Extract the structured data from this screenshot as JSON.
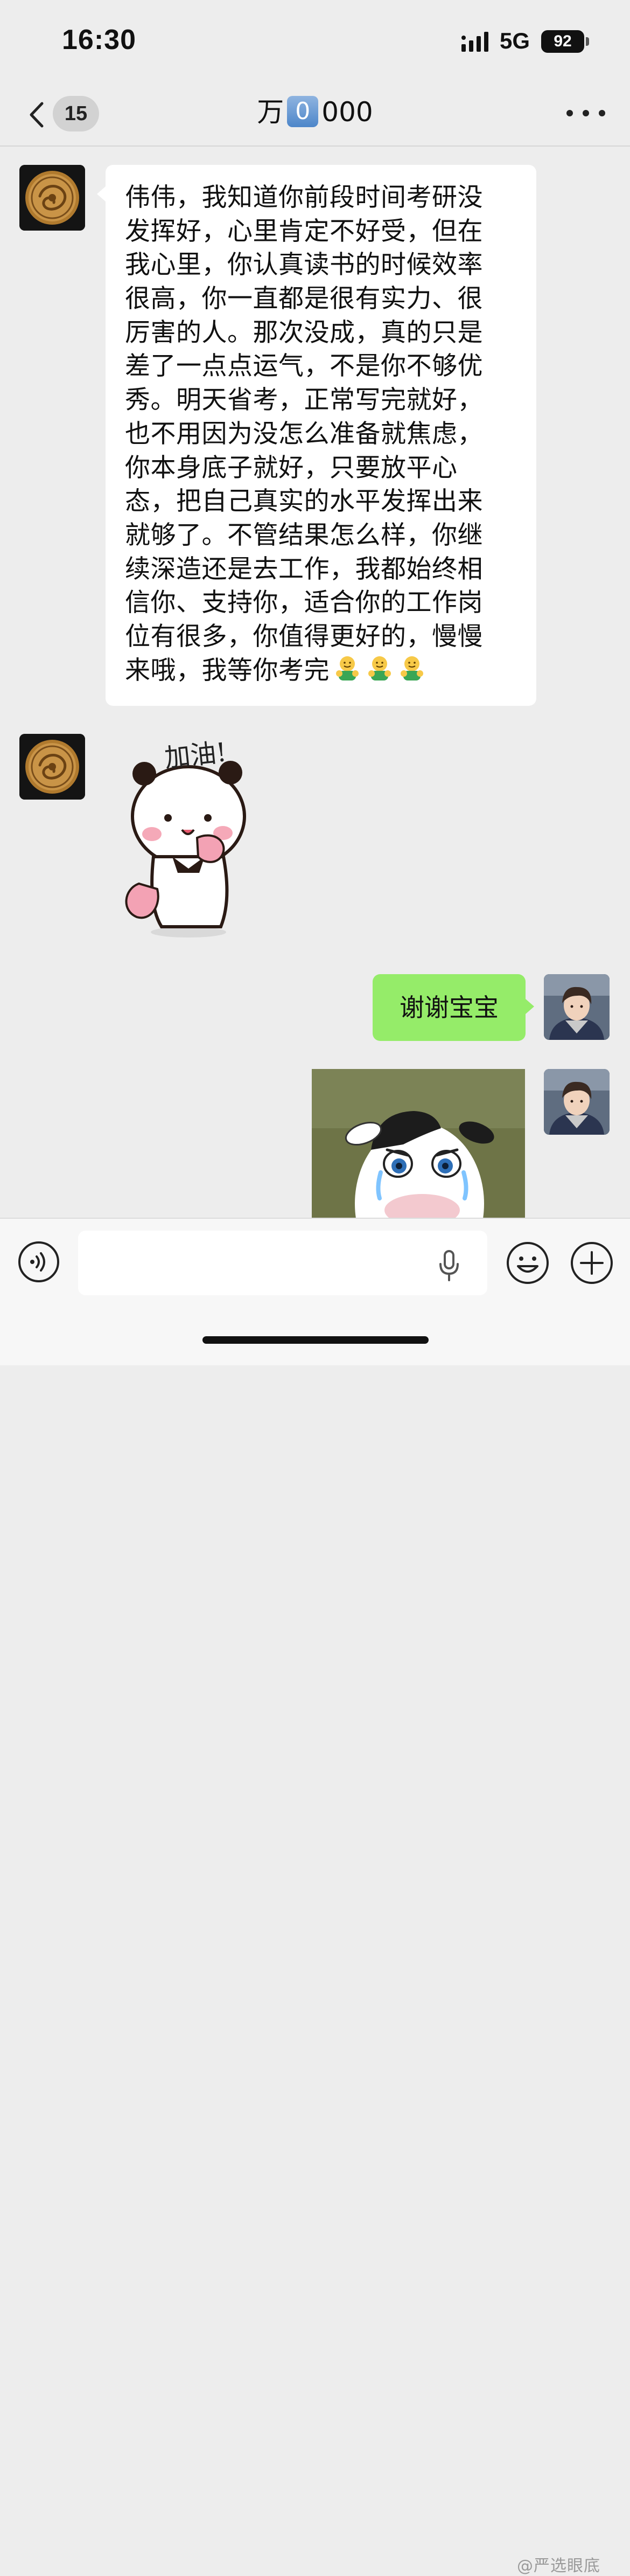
{
  "status_bar": {
    "time": "16:30",
    "network": "5G",
    "battery": "92",
    "signal_icon": "signal-bars-icon",
    "battery_icon": "battery-icon"
  },
  "nav": {
    "back_icon": "chevron-left-icon",
    "unread_count": "15",
    "title_prefix": "万",
    "title_boxed_digit": "0",
    "title_suffix": "000",
    "more_icon": "ellipsis-icon"
  },
  "messages": [
    {
      "sender": "contact",
      "type": "text",
      "lines": [
        "伟伟，我知道你前段时间考研没",
        "发挥好，心里肯定不好受，但在",
        "我心里，你认真读书的时候效率",
        "很高，你一直都是很有实力、很",
        "厉害的人。那次没成，真的只是",
        "差了一点点运气，不是你不够优",
        "秀。明天省考，正常写完就好，",
        "也不用因为没怎么准备就焦虑，",
        "你本身底子就好，只要放平心",
        "态，把自己真实的水平发挥出来",
        "就够了。不管结果怎么样，你继",
        "续深造还是去工作，我都始终相",
        "信你、支持你，适合你的工作岗",
        "位有很多，你值得更好的，慢慢",
        "来哦，我等你考完"
      ],
      "trailing_emoji": [
        "hug-emoji",
        "hug-emoji",
        "hug-emoji"
      ]
    },
    {
      "sender": "contact",
      "type": "sticker",
      "sticker": "panda-cheer-sticker",
      "caption": "加油!"
    },
    {
      "sender": "self",
      "type": "text",
      "text": "谢谢宝宝"
    },
    {
      "sender": "self",
      "type": "sticker",
      "sticker": "crying-cow-sticker"
    }
  ],
  "input_bar": {
    "voice_icon": "voice-wave-icon",
    "placeholder": "",
    "mic_icon": "microphone-icon",
    "emoji_icon": "smiley-icon",
    "plus_icon": "plus-circle-icon"
  },
  "watermark": "@严选眼底",
  "colors": {
    "background": "#ededed",
    "sent_bubble": "#95ec69",
    "received_bubble": "#ffffff",
    "input_bar": "#f7f7f7"
  }
}
